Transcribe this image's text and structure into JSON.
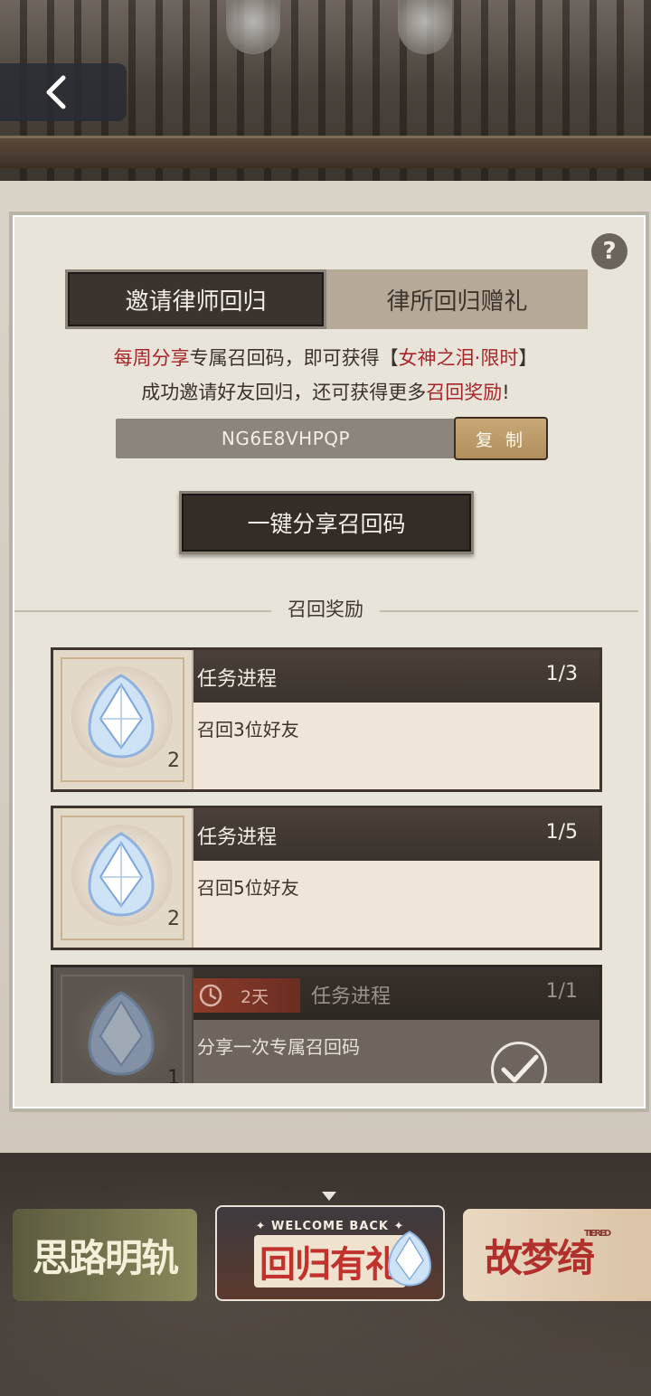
{
  "nav": {
    "back_icon": "chevron-left-icon"
  },
  "help": {
    "label": "?"
  },
  "tabs": [
    {
      "label": "邀请律师回归",
      "active": true
    },
    {
      "label": "律所回归赠礼",
      "active": false
    }
  ],
  "description": {
    "line1_part1": "每周分享",
    "line1_part2": "专属召回码，即可获得【",
    "line1_part3": "女神之泪·限时",
    "line1_part4": "】",
    "line2_part1": "成功邀请好友回归，还可获得更多",
    "line2_part2": "召回奖励",
    "line2_part3": "!"
  },
  "recall_code": {
    "value": "NG6E8VHPQP",
    "copy_label": "复 制"
  },
  "share_button": {
    "label": "一键分享召回码"
  },
  "section": {
    "title": "召回奖励"
  },
  "tasks": [
    {
      "header": "任务进程",
      "progress": "1/3",
      "description": "召回3位好友",
      "reward_count": "2",
      "completed": false
    },
    {
      "header": "任务进程",
      "progress": "1/5",
      "description": "召回5位好友",
      "reward_count": "2",
      "completed": false
    },
    {
      "header": "任务进程",
      "progress": "1/1",
      "description": "分享一次专属召回码",
      "reward_count": "1",
      "completed": true,
      "timer": "2天"
    }
  ],
  "banners": {
    "left": "思路明轨",
    "middle_small": "✦ WELCOME BACK ✦",
    "middle_main": "回归有礼",
    "right": "故梦绮",
    "right_small": "TIERED"
  },
  "colors": {
    "accent_red": "#a8262a",
    "dark_button": "#332c27",
    "copy_gold": "#c8a877"
  }
}
